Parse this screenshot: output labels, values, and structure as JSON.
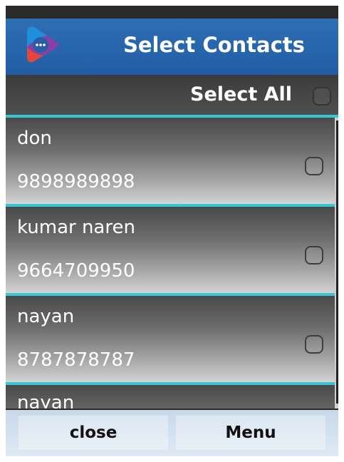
{
  "header": {
    "title": "Select Contacts",
    "logo_icon": "chat-app-logo-icon"
  },
  "select_all": {
    "label": "Select All",
    "checked": false
  },
  "contacts": [
    {
      "name": "don",
      "number": "9898989898",
      "checked": false
    },
    {
      "name": "kumar naren",
      "number": "9664709950",
      "checked": false
    },
    {
      "name": "nayan",
      "number": "8787878787",
      "checked": false
    },
    {
      "name": "nayan",
      "checked": false
    }
  ],
  "softkeys": {
    "left": "close",
    "right": "Menu"
  },
  "colors": {
    "header": "#2f6fb4",
    "divider": "#39c6d4",
    "softkey_bar": "#c7d8ea"
  }
}
